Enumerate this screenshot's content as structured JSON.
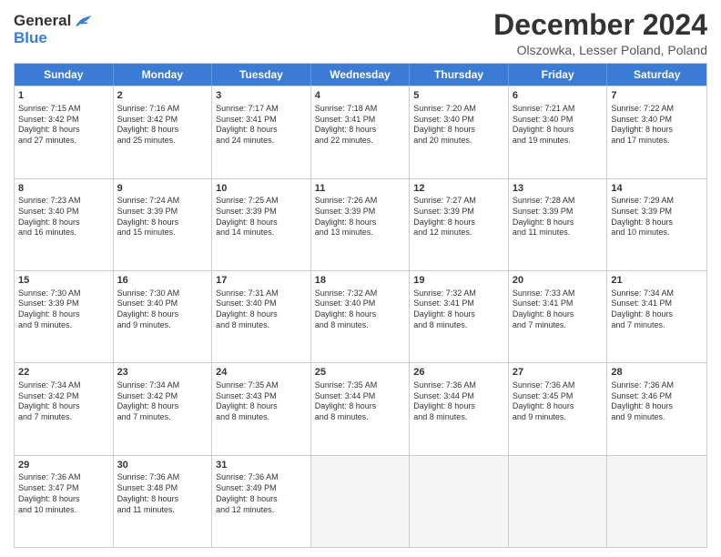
{
  "header": {
    "logo_general": "General",
    "logo_blue": "Blue",
    "month_title": "December 2024",
    "location": "Olszowka, Lesser Poland, Poland"
  },
  "days_of_week": [
    "Sunday",
    "Monday",
    "Tuesday",
    "Wednesday",
    "Thursday",
    "Friday",
    "Saturday"
  ],
  "weeks": [
    [
      {
        "day": 1,
        "lines": [
          "Sunrise: 7:15 AM",
          "Sunset: 3:42 PM",
          "Daylight: 8 hours",
          "and 27 minutes."
        ]
      },
      {
        "day": 2,
        "lines": [
          "Sunrise: 7:16 AM",
          "Sunset: 3:42 PM",
          "Daylight: 8 hours",
          "and 25 minutes."
        ]
      },
      {
        "day": 3,
        "lines": [
          "Sunrise: 7:17 AM",
          "Sunset: 3:41 PM",
          "Daylight: 8 hours",
          "and 24 minutes."
        ]
      },
      {
        "day": 4,
        "lines": [
          "Sunrise: 7:18 AM",
          "Sunset: 3:41 PM",
          "Daylight: 8 hours",
          "and 22 minutes."
        ]
      },
      {
        "day": 5,
        "lines": [
          "Sunrise: 7:20 AM",
          "Sunset: 3:40 PM",
          "Daylight: 8 hours",
          "and 20 minutes."
        ]
      },
      {
        "day": 6,
        "lines": [
          "Sunrise: 7:21 AM",
          "Sunset: 3:40 PM",
          "Daylight: 8 hours",
          "and 19 minutes."
        ]
      },
      {
        "day": 7,
        "lines": [
          "Sunrise: 7:22 AM",
          "Sunset: 3:40 PM",
          "Daylight: 8 hours",
          "and 17 minutes."
        ]
      }
    ],
    [
      {
        "day": 8,
        "lines": [
          "Sunrise: 7:23 AM",
          "Sunset: 3:40 PM",
          "Daylight: 8 hours",
          "and 16 minutes."
        ]
      },
      {
        "day": 9,
        "lines": [
          "Sunrise: 7:24 AM",
          "Sunset: 3:39 PM",
          "Daylight: 8 hours",
          "and 15 minutes."
        ]
      },
      {
        "day": 10,
        "lines": [
          "Sunrise: 7:25 AM",
          "Sunset: 3:39 PM",
          "Daylight: 8 hours",
          "and 14 minutes."
        ]
      },
      {
        "day": 11,
        "lines": [
          "Sunrise: 7:26 AM",
          "Sunset: 3:39 PM",
          "Daylight: 8 hours",
          "and 13 minutes."
        ]
      },
      {
        "day": 12,
        "lines": [
          "Sunrise: 7:27 AM",
          "Sunset: 3:39 PM",
          "Daylight: 8 hours",
          "and 12 minutes."
        ]
      },
      {
        "day": 13,
        "lines": [
          "Sunrise: 7:28 AM",
          "Sunset: 3:39 PM",
          "Daylight: 8 hours",
          "and 11 minutes."
        ]
      },
      {
        "day": 14,
        "lines": [
          "Sunrise: 7:29 AM",
          "Sunset: 3:39 PM",
          "Daylight: 8 hours",
          "and 10 minutes."
        ]
      }
    ],
    [
      {
        "day": 15,
        "lines": [
          "Sunrise: 7:30 AM",
          "Sunset: 3:39 PM",
          "Daylight: 8 hours",
          "and 9 minutes."
        ]
      },
      {
        "day": 16,
        "lines": [
          "Sunrise: 7:30 AM",
          "Sunset: 3:40 PM",
          "Daylight: 8 hours",
          "and 9 minutes."
        ]
      },
      {
        "day": 17,
        "lines": [
          "Sunrise: 7:31 AM",
          "Sunset: 3:40 PM",
          "Daylight: 8 hours",
          "and 8 minutes."
        ]
      },
      {
        "day": 18,
        "lines": [
          "Sunrise: 7:32 AM",
          "Sunset: 3:40 PM",
          "Daylight: 8 hours",
          "and 8 minutes."
        ]
      },
      {
        "day": 19,
        "lines": [
          "Sunrise: 7:32 AM",
          "Sunset: 3:41 PM",
          "Daylight: 8 hours",
          "and 8 minutes."
        ]
      },
      {
        "day": 20,
        "lines": [
          "Sunrise: 7:33 AM",
          "Sunset: 3:41 PM",
          "Daylight: 8 hours",
          "and 7 minutes."
        ]
      },
      {
        "day": 21,
        "lines": [
          "Sunrise: 7:34 AM",
          "Sunset: 3:41 PM",
          "Daylight: 8 hours",
          "and 7 minutes."
        ]
      }
    ],
    [
      {
        "day": 22,
        "lines": [
          "Sunrise: 7:34 AM",
          "Sunset: 3:42 PM",
          "Daylight: 8 hours",
          "and 7 minutes."
        ]
      },
      {
        "day": 23,
        "lines": [
          "Sunrise: 7:34 AM",
          "Sunset: 3:42 PM",
          "Daylight: 8 hours",
          "and 7 minutes."
        ]
      },
      {
        "day": 24,
        "lines": [
          "Sunrise: 7:35 AM",
          "Sunset: 3:43 PM",
          "Daylight: 8 hours",
          "and 8 minutes."
        ]
      },
      {
        "day": 25,
        "lines": [
          "Sunrise: 7:35 AM",
          "Sunset: 3:44 PM",
          "Daylight: 8 hours",
          "and 8 minutes."
        ]
      },
      {
        "day": 26,
        "lines": [
          "Sunrise: 7:36 AM",
          "Sunset: 3:44 PM",
          "Daylight: 8 hours",
          "and 8 minutes."
        ]
      },
      {
        "day": 27,
        "lines": [
          "Sunrise: 7:36 AM",
          "Sunset: 3:45 PM",
          "Daylight: 8 hours",
          "and 9 minutes."
        ]
      },
      {
        "day": 28,
        "lines": [
          "Sunrise: 7:36 AM",
          "Sunset: 3:46 PM",
          "Daylight: 8 hours",
          "and 9 minutes."
        ]
      }
    ],
    [
      {
        "day": 29,
        "lines": [
          "Sunrise: 7:36 AM",
          "Sunset: 3:47 PM",
          "Daylight: 8 hours",
          "and 10 minutes."
        ]
      },
      {
        "day": 30,
        "lines": [
          "Sunrise: 7:36 AM",
          "Sunset: 3:48 PM",
          "Daylight: 8 hours",
          "and 11 minutes."
        ]
      },
      {
        "day": 31,
        "lines": [
          "Sunrise: 7:36 AM",
          "Sunset: 3:49 PM",
          "Daylight: 8 hours",
          "and 12 minutes."
        ]
      },
      null,
      null,
      null,
      null
    ]
  ]
}
